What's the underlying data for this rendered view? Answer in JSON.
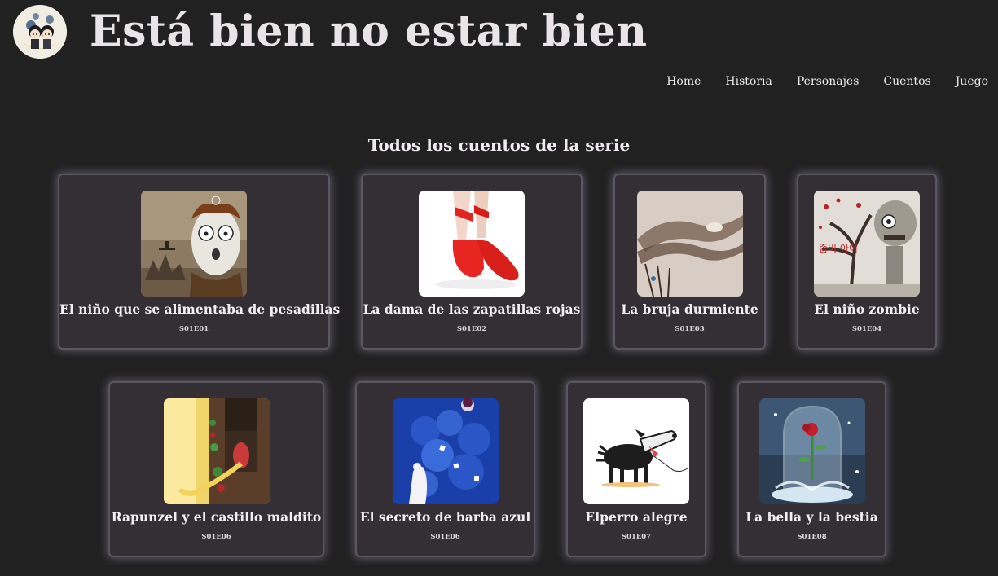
{
  "header": {
    "site_title": "Está bien no estar bien",
    "logo_icon": "couple-moon-logo-icon"
  },
  "nav": {
    "items": [
      "Home",
      "Historia",
      "Personajes",
      "Cuentos",
      "Juego"
    ]
  },
  "main": {
    "section_title": "Todos los cuentos de la serie",
    "stories": [
      {
        "title": "El niño que se alimentaba de pesadillas",
        "code": "S01E01",
        "image": "nightmare-boy-illustration"
      },
      {
        "title": "La dama de las zapatillas rojas",
        "code": "S01E02",
        "image": "red-ballet-shoes-photo"
      },
      {
        "title": "La bruja durmiente",
        "code": "S01E03",
        "image": "sleeping-witch-illustration"
      },
      {
        "title": "El niño zombie",
        "code": "S01E04",
        "image": "zombie-child-illustration"
      },
      {
        "title": "Rapunzel y el castillo maldito",
        "code": "S01E06",
        "image": "rapunzel-tower-illustration"
      },
      {
        "title": "El secreto de barba azul",
        "code": "S01E06",
        "image": "bluebeard-illustration"
      },
      {
        "title": "Elperro alegre",
        "code": "S01E07",
        "image": "happy-dog-illustration"
      },
      {
        "title": "La bella y la bestia",
        "code": "S01E08",
        "image": "rose-glass-dome-illustration"
      }
    ]
  },
  "colors": {
    "background": "#222122",
    "card_background": "#332f35",
    "card_border": "#5b5661",
    "text": "#ebe7ea"
  }
}
